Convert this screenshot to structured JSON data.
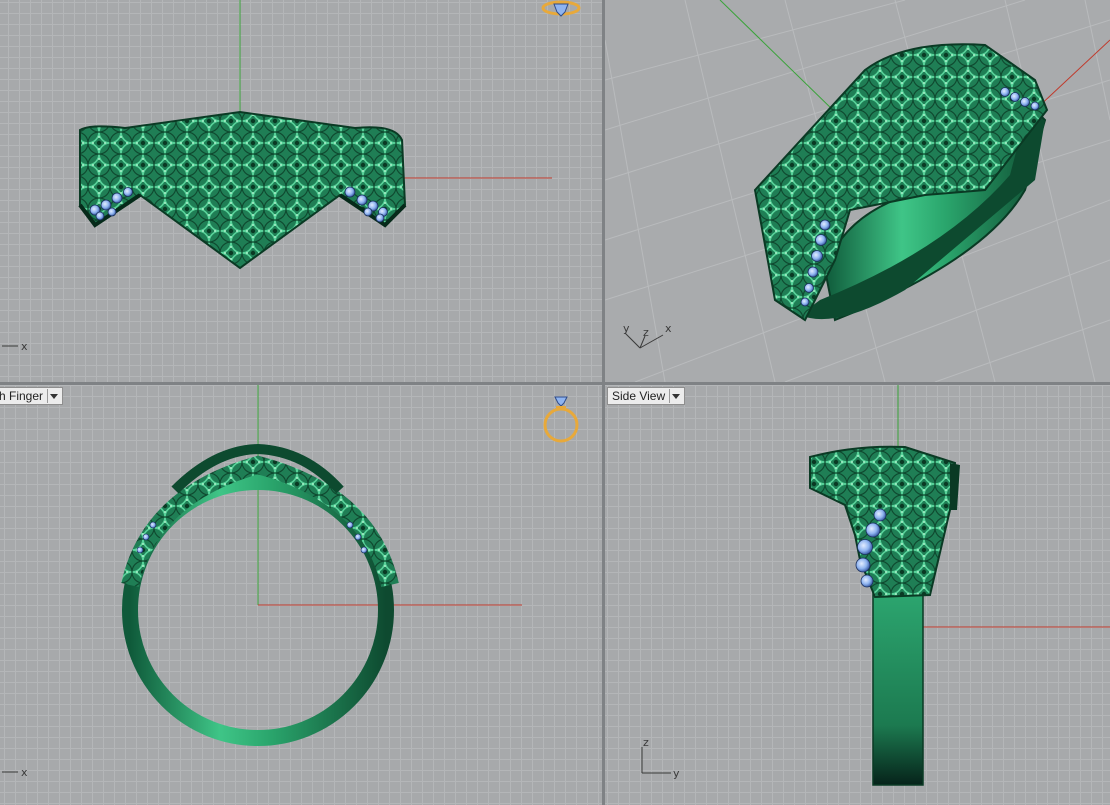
{
  "viewports": {
    "front": {
      "axis_x": "x"
    },
    "perspective": {
      "axis_y": "y",
      "axis_z": "z",
      "axis_x": "x"
    },
    "top": {
      "label": "h Finger",
      "axis_x": "x"
    },
    "side": {
      "label": "Side View",
      "axis_z": "z",
      "axis_y": "y"
    }
  },
  "colors": {
    "viewport_bg": "#a7a9ab",
    "grid_minor": "#b4b6b8",
    "grid_major": "#999b9e",
    "metal_green": "#1f8a5c",
    "metal_dark": "#0b3d27",
    "gem_blue": "#8fb4f0",
    "axis_red": "#c0392b",
    "axis_green": "#3aa33a",
    "icon_gold": "#e8a93a"
  },
  "icons": [
    "ring-gem-icon"
  ]
}
